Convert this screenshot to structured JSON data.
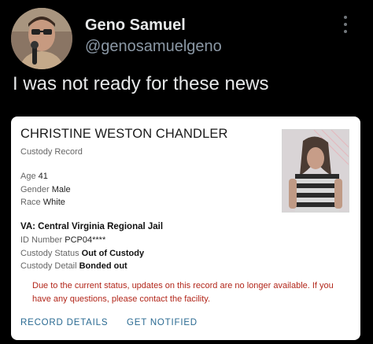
{
  "tweet": {
    "author_name": "Geno Samuel",
    "author_handle": "@genosamuelgeno",
    "text": "I was not ready for these news"
  },
  "record": {
    "name": "CHRISTINE WESTON CHANDLER",
    "subtitle": "Custody Record",
    "age_label": "Age",
    "age_value": "41",
    "gender_label": "Gender",
    "gender_value": "Male",
    "race_label": "Race",
    "race_value": "White",
    "facility": "VA: Central Virginia Regional Jail",
    "id_label": "ID Number",
    "id_value": "PCP04****",
    "status_label": "Custody Status",
    "status_value": "Out of Custody",
    "detail_label": "Custody Detail",
    "detail_value": "Bonded out",
    "notice": "Due to the current status, updates on this record are no longer available. If you have any questions, please contact the facility.",
    "link_details": "RECORD DETAILS",
    "link_notified": "GET NOTIFIED"
  },
  "colors": {
    "background": "#000000",
    "card": "#ffffff",
    "notice": "#b2261a",
    "link": "#2a6a92"
  },
  "icons": [
    "more-options-icon"
  ]
}
